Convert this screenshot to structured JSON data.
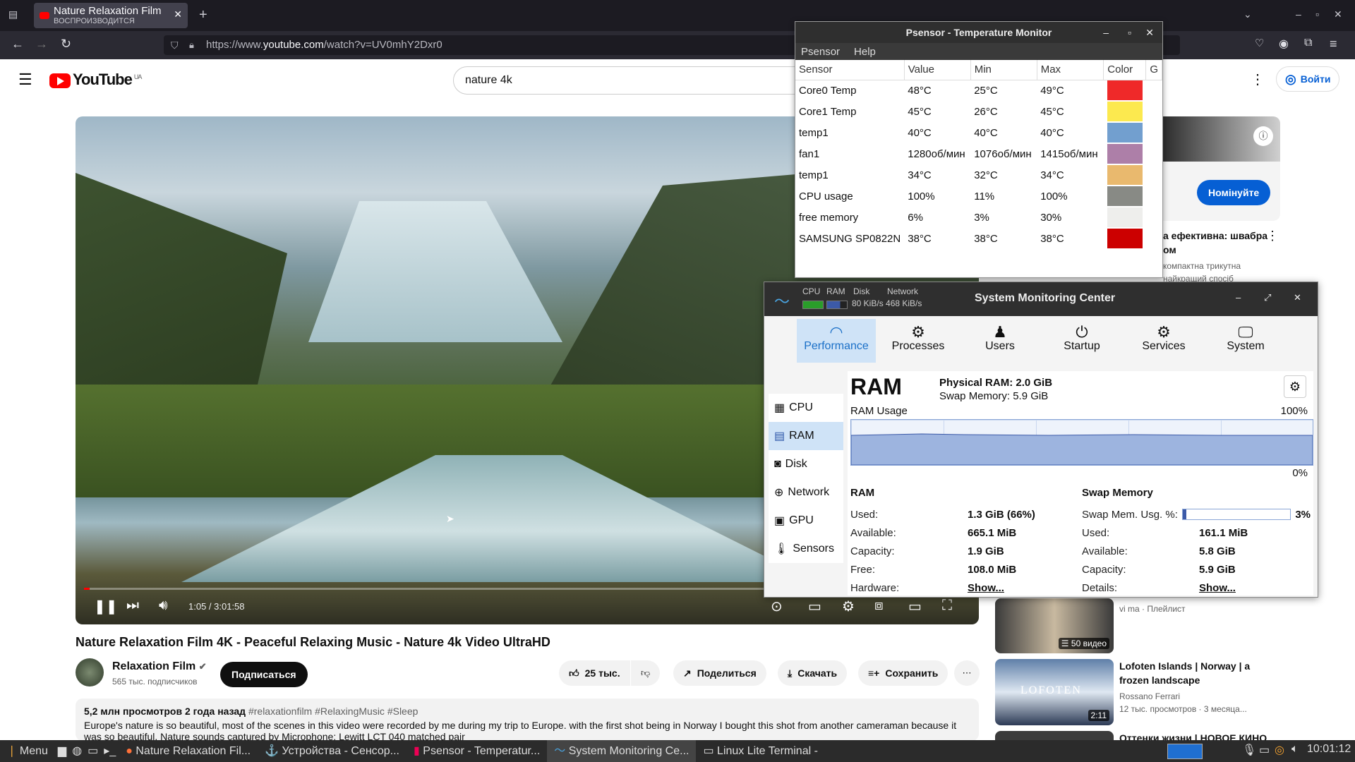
{
  "browser": {
    "tab_title": "Nature Relaxation Film",
    "tab_sub": "ВОСПРОИЗВОДИТСЯ",
    "url_prefix": "https://www.",
    "url_domain": "youtube.com",
    "url_path": "/watch?v=UV0mhY2Dxr0"
  },
  "youtube": {
    "logo": "YouTube",
    "region": "UA",
    "search_value": "nature 4k",
    "login_label": "Войти",
    "video_title": "Nature Relaxation Film 4K - Peaceful Relaxing Music - Nature 4k Video UltraHD",
    "time": "1:05 / 3:01:58",
    "progress_fraction": 0.006,
    "channel_name": "Relaxation Film",
    "subscribers": "565 тыс. подписчиков",
    "subscribe_label": "Подписаться",
    "likes": "25 тыс.",
    "share_label": "Поделиться",
    "download_label": "Скачать",
    "save_label": "Сохранить",
    "views_line": "5,2 млн просмотров  2 года назад",
    "hashtags": "#relaxationfilm #RelaxingMusic #Sleep",
    "description": "Europe's nature is so beautiful, most of the scenes in this video were recorded by me during my trip to Europe. with the first shot being in Norway I bought this shot from another cameraman because it",
    "description2": "was so beautiful. Nature sounds captured by Microphone: Lewitt LCT 040 matched pair",
    "ad_button": "Номінуйте",
    "ad_title": "а ефективна: швабра",
    "ad_title2": "ом",
    "ad_sub": "компактна трикутна",
    "ad_sub2": "найкращий спосіб",
    "rec": [
      {
        "sub": "vi ma · Плейлист",
        "badge": "50 видео"
      },
      {
        "title": "Lofoten Islands | Norway | a frozen landscape",
        "channel": "Rossano Ferrari",
        "meta": "12 тыс. просмотров · 3 месяца...",
        "duration": "2:11",
        "thumb_text": "LOFOTEN"
      },
      {
        "title": "Оттенки жизни | НОВОЕ КИНО"
      }
    ]
  },
  "psensor": {
    "title": "Psensor - Temperature Monitor",
    "menu": [
      "Psensor",
      "Help"
    ],
    "columns": [
      "Sensor",
      "Value",
      "Min",
      "Max",
      "Color",
      "G"
    ],
    "rows": [
      {
        "sensor": "Core0 Temp",
        "value": "48°C",
        "min": "25°C",
        "max": "49°C",
        "color": "#ef2929"
      },
      {
        "sensor": "Core1 Temp",
        "value": "45°C",
        "min": "26°C",
        "max": "45°C",
        "color": "#fce94f"
      },
      {
        "sensor": "temp1",
        "value": "40°C",
        "min": "40°C",
        "max": "40°C",
        "color": "#729fcf"
      },
      {
        "sensor": "fan1",
        "value": "1280об/мин",
        "min": "1076об/мин",
        "max": "1415об/мин",
        "color": "#ad7fa8"
      },
      {
        "sensor": "temp1",
        "value": "34°C",
        "min": "32°C",
        "max": "34°C",
        "color": "#e9b96e"
      },
      {
        "sensor": "CPU usage",
        "value": "100%",
        "min": "11%",
        "max": "100%",
        "color": "#888a85"
      },
      {
        "sensor": "free memory",
        "value": "6%",
        "min": "3%",
        "max": "30%",
        "color": "#eeeeec"
      },
      {
        "sensor": "SAMSUNG SP0822N",
        "value": "38°C",
        "min": "38°C",
        "max": "38°C",
        "color": "#cc0000"
      }
    ]
  },
  "smc": {
    "title": "System Monitoring Center",
    "mini_labels": [
      "CPU",
      "RAM",
      "Disk",
      "Network"
    ],
    "mini_net": "80 KiB/s 468 KiB/s",
    "tabs": [
      "Performance",
      "Processes",
      "Users",
      "Startup",
      "Services",
      "System"
    ],
    "side": [
      "CPU",
      "RAM",
      "Disk",
      "Network",
      "GPU",
      "Sensors"
    ],
    "heading": "RAM",
    "physical": "Physical RAM: 2.0 GiB",
    "swap": "Swap Memory: 5.9 GiB",
    "usage_label": "RAM Usage",
    "max_label": "100%",
    "min_label": "0%",
    "ram_section": "RAM",
    "swap_section": "Swap Memory",
    "ram_used_pct": 0.66,
    "swap_used_pct": 0.03,
    "ram_kv": [
      {
        "k": "Used:",
        "v": "1.3 GiB (66%)"
      },
      {
        "k": "Available:",
        "v": "665.1 MiB"
      },
      {
        "k": "Capacity:",
        "v": "1.9 GiB"
      },
      {
        "k": "Free:",
        "v": "108.0 MiB"
      },
      {
        "k": "Hardware:",
        "v": "Show..."
      }
    ],
    "swap_usage_label": "Swap Mem. Usg. %:",
    "swap_usage_value": "3%",
    "swap_kv": [
      {
        "k": "Used:",
        "v": "161.1 MiB"
      },
      {
        "k": "Available:",
        "v": "5.8 GiB"
      },
      {
        "k": "Capacity:",
        "v": "5.9 GiB"
      },
      {
        "k": "Details:",
        "v": "Show..."
      }
    ]
  },
  "taskbar": {
    "menu": "Menu",
    "items": [
      "Nature Relaxation Fil...",
      "Устройства - Сенсор...",
      "Psensor - Temperatur...",
      "System Monitoring Ce...",
      "Linux Lite Terminal -"
    ],
    "clock": "10:01:12"
  }
}
